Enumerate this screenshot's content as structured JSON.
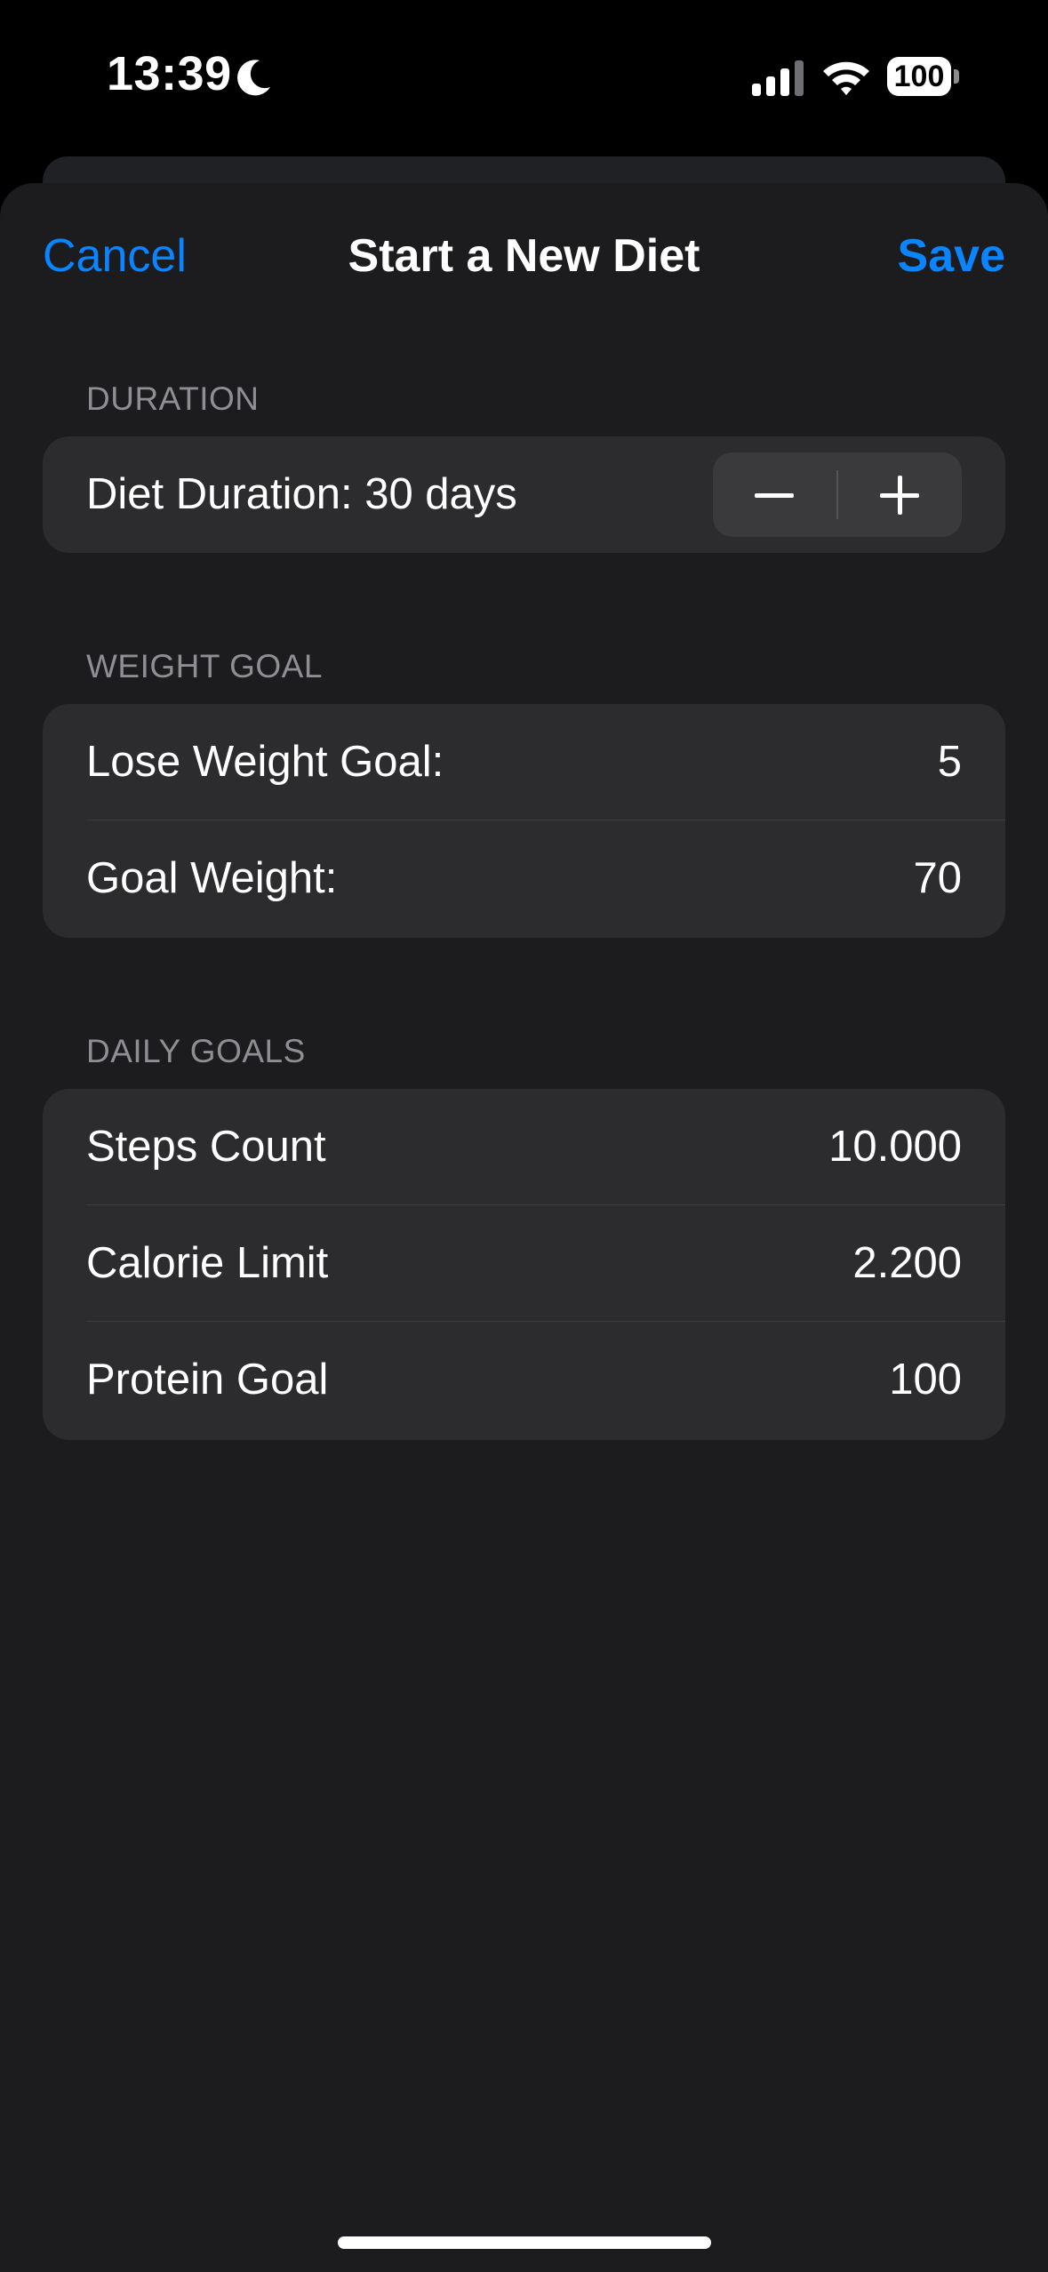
{
  "status_bar": {
    "time": "13:39",
    "battery": "100",
    "icons": [
      "moon-icon",
      "cellular-signal-icon",
      "wifi-icon",
      "battery-icon"
    ]
  },
  "nav": {
    "cancel_label": "Cancel",
    "title": "Start a New Diet",
    "save_label": "Save"
  },
  "duration": {
    "header": "DURATION",
    "label": "Diet Duration: 30 days"
  },
  "weight_goal": {
    "header": "WEIGHT GOAL",
    "rows": [
      {
        "label": "Lose Weight Goal:",
        "value": "5"
      },
      {
        "label": "Goal Weight:",
        "value": "70"
      }
    ]
  },
  "daily_goals": {
    "header": "DAILY GOALS",
    "rows": [
      {
        "label": "Steps Count",
        "value": "10.000"
      },
      {
        "label": "Calorie Limit",
        "value": "2.200"
      },
      {
        "label": "Protein Goal",
        "value": "100"
      }
    ]
  },
  "colors": {
    "accent": "#0a84ff",
    "background": "#1c1c1e",
    "cell": "#2c2c2e"
  }
}
